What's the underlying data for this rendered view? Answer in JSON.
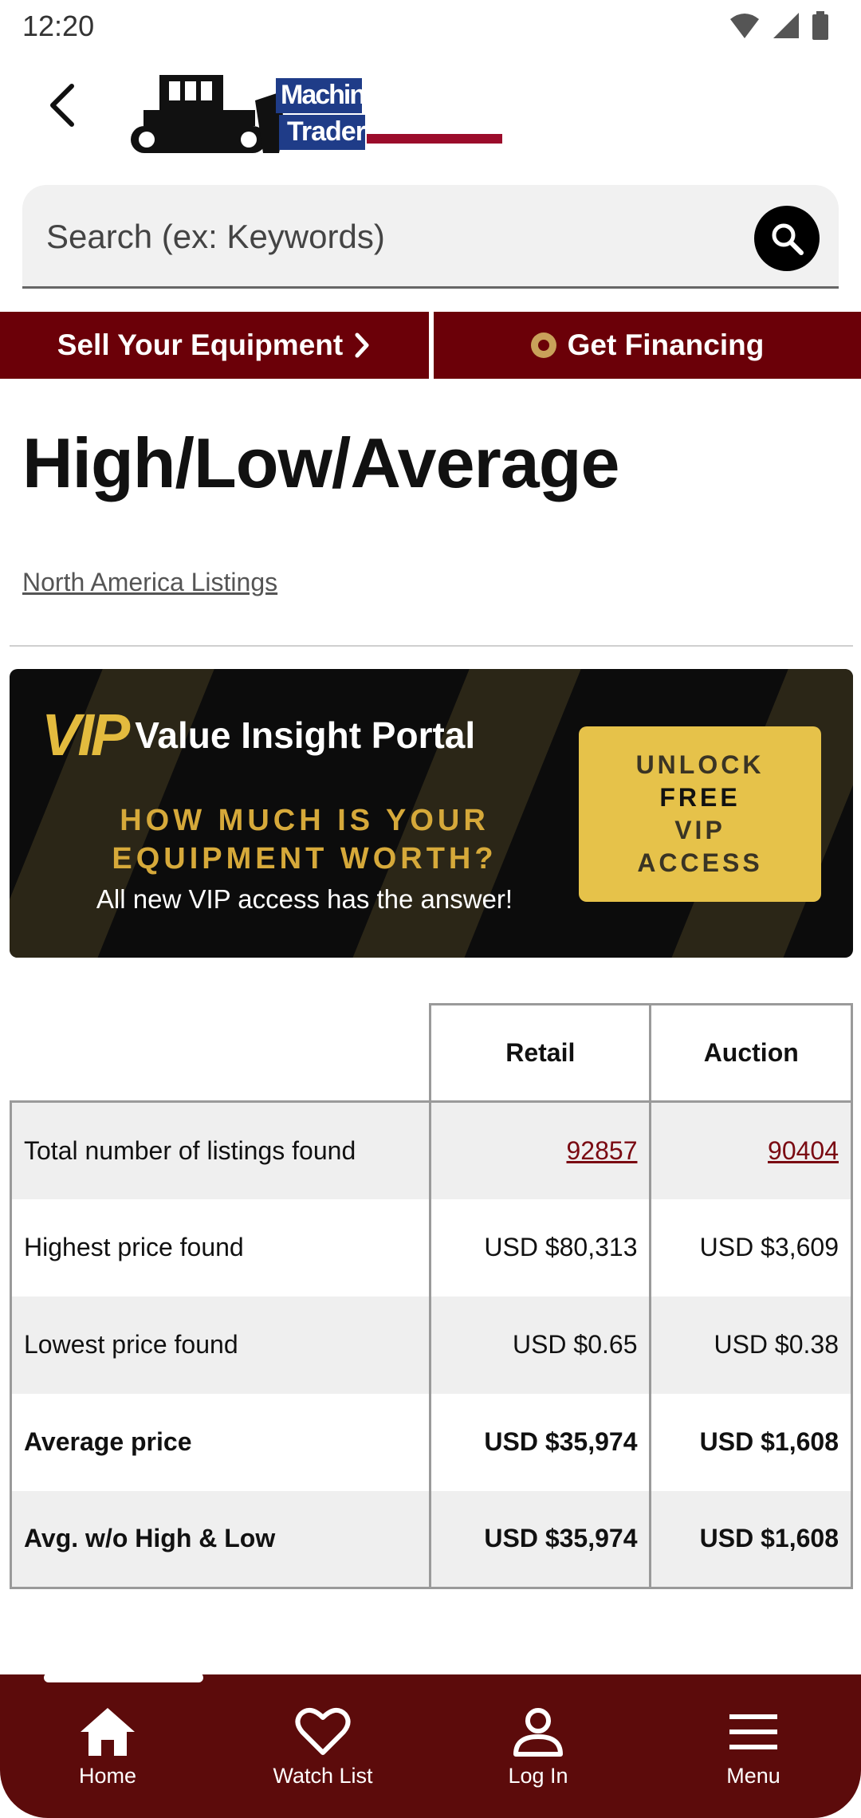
{
  "status_bar": {
    "time": "12:20"
  },
  "header": {
    "logo_text_1": "Machinery",
    "logo_text_2": "Trader"
  },
  "search": {
    "placeholder": "Search (ex: Keywords)"
  },
  "promo": {
    "sell_label": "Sell Your Equipment",
    "financing_label": "Get Financing"
  },
  "page": {
    "title": "High/Low/Average",
    "region_link": "North America Listings"
  },
  "vip_banner": {
    "mark": "VIP",
    "portal_name": "Value Insight Portal",
    "question_line1": "HOW MUCH IS YOUR",
    "question_line2": "EQUIPMENT WORTH?",
    "answer": "All new VIP access has the answer!",
    "cta_line1": "UNLOCK",
    "cta_line2": "FREE",
    "cta_line3": "VIP",
    "cta_line4": "ACCESS",
    "gold": "#e6c24a"
  },
  "table": {
    "headers": {
      "retail": "Retail",
      "auction": "Auction"
    },
    "rows": [
      {
        "label": "Total number of listings found",
        "retail": "92857",
        "auction": "90404"
      },
      {
        "label": "Highest price found",
        "retail": "USD $80,313",
        "auction": "USD $3,609"
      },
      {
        "label": "Lowest price found",
        "retail": "USD $0.65",
        "auction": "USD $0.38"
      },
      {
        "label": "Average price",
        "retail": "USD $35,974",
        "auction": "USD $1,608"
      },
      {
        "label": "Avg. w/o High & Low",
        "retail": "USD $35,974",
        "auction": "USD $1,608"
      }
    ]
  },
  "bottom_nav": {
    "items": [
      {
        "label": "Home",
        "icon": "home-icon"
      },
      {
        "label": "Watch List",
        "icon": "heart-icon"
      },
      {
        "label": "Log In",
        "icon": "user-icon"
      },
      {
        "label": "Menu",
        "icon": "menu-icon"
      }
    ]
  },
  "colors": {
    "brand_red": "#6b0008",
    "nav_red": "#5c0b0b",
    "link_red": "#7a0a12"
  }
}
